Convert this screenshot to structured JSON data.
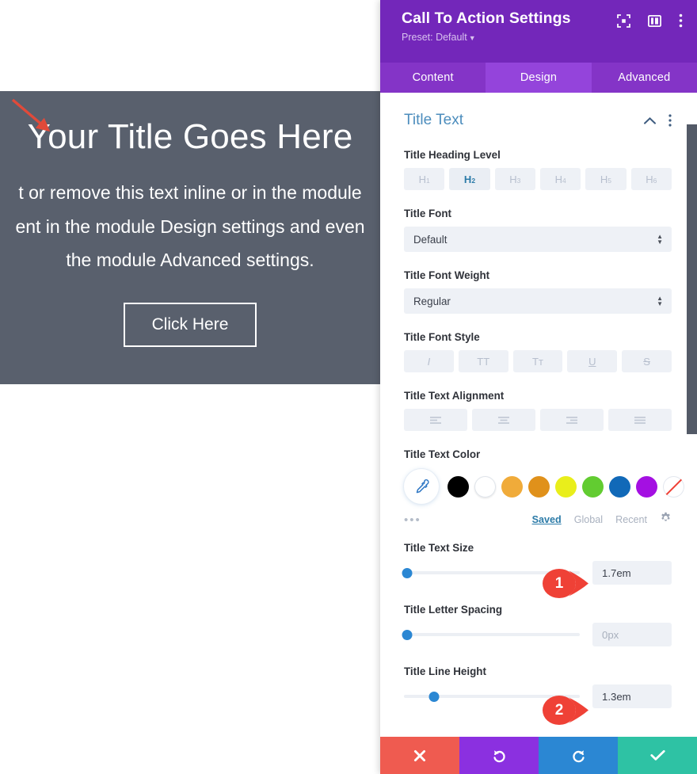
{
  "preview": {
    "title": "Your Title Goes Here",
    "body_line1": "t or remove this text inline or in the module",
    "body_line2": "ent in the module Design settings and even",
    "body_line3": "the module Advanced settings.",
    "button_label": "Click Here",
    "background_color": "#59606d",
    "annotation_arrow_color": "#e04a3a"
  },
  "panel": {
    "header": {
      "title": "Call To Action Settings",
      "preset_label": "Preset: Default",
      "background_color": "#7327ba",
      "icons": [
        "fullscreen-icon",
        "layout-panel-icon",
        "more-vertical-icon"
      ]
    },
    "tabs": [
      {
        "label": "Content",
        "active": false
      },
      {
        "label": "Design",
        "active": true
      },
      {
        "label": "Advanced",
        "active": false
      }
    ],
    "section": {
      "title": "Title Text",
      "title_color": "#4c8dbd",
      "collapse_icon": "chevron-up-icon",
      "menu_icon": "more-vertical-icon"
    },
    "fields": {
      "heading_level": {
        "label": "Title Heading Level",
        "options": [
          {
            "tag": "H",
            "num": "1",
            "active": false
          },
          {
            "tag": "H",
            "num": "2",
            "active": true
          },
          {
            "tag": "H",
            "num": "3",
            "active": false
          },
          {
            "tag": "H",
            "num": "4",
            "active": false
          },
          {
            "tag": "H",
            "num": "5",
            "active": false
          },
          {
            "tag": "H",
            "num": "6",
            "active": false
          }
        ]
      },
      "title_font": {
        "label": "Title Font",
        "value": "Default",
        "options": [
          "Default"
        ]
      },
      "title_font_weight": {
        "label": "Title Font Weight",
        "value": "Regular",
        "options": [
          "Regular"
        ]
      },
      "title_font_style": {
        "label": "Title Font Style",
        "options": [
          {
            "glyph": "I",
            "name": "italic",
            "active": false
          },
          {
            "glyph": "TT",
            "name": "uppercase",
            "active": false
          },
          {
            "glyph": "Tᴛ",
            "name": "small-caps",
            "active": false
          },
          {
            "glyph": "U",
            "name": "underline",
            "active": false
          },
          {
            "glyph": "S",
            "name": "strikethrough",
            "active": false
          }
        ]
      },
      "title_text_alignment": {
        "label": "Title Text Alignment",
        "options": [
          {
            "name": "align-left",
            "active": false
          },
          {
            "name": "align-center",
            "active": false
          },
          {
            "name": "align-right",
            "active": false
          },
          {
            "name": "align-justify",
            "active": false
          }
        ]
      },
      "title_text_color": {
        "label": "Title Text Color",
        "eyedropper_icon": "eyedropper-icon",
        "swatches": [
          {
            "name": "black",
            "hex": "#000000"
          },
          {
            "name": "white",
            "hex": "#ffffff"
          },
          {
            "name": "amber",
            "hex": "#f0ab3a"
          },
          {
            "name": "dark-orange",
            "hex": "#e0911b"
          },
          {
            "name": "yellow",
            "hex": "#e9ee1b"
          },
          {
            "name": "green",
            "hex": "#62cc31"
          },
          {
            "name": "blue",
            "hex": "#1169b8"
          },
          {
            "name": "magenta",
            "hex": "#a410e2"
          },
          {
            "name": "transparent",
            "hex": "none"
          }
        ],
        "more_dots": "•••",
        "tabs": [
          {
            "label": "Saved",
            "active": true
          },
          {
            "label": "Global",
            "active": false
          },
          {
            "label": "Recent",
            "active": false
          }
        ],
        "settings_icon": "gear-icon"
      },
      "title_text_size": {
        "label": "Title Text Size",
        "value": "1.7em",
        "knob_percent": 2,
        "badge": "1"
      },
      "title_letter_spacing": {
        "label": "Title Letter Spacing",
        "value": "",
        "placeholder": "0px",
        "knob_percent": 2,
        "badge": null
      },
      "title_line_height": {
        "label": "Title Line Height",
        "value": "1.3em",
        "knob_percent": 17,
        "badge": "2"
      }
    },
    "footer": [
      {
        "name": "cancel-button",
        "icon": "close-icon",
        "color": "#ef5b50"
      },
      {
        "name": "undo-button",
        "icon": "undo-icon",
        "color": "#8b30e0"
      },
      {
        "name": "redo-button",
        "icon": "redo-icon",
        "color": "#2b87d3"
      },
      {
        "name": "save-button",
        "icon": "check-icon",
        "color": "#2ec2a4"
      }
    ],
    "badge_color": "#ef4136"
  }
}
